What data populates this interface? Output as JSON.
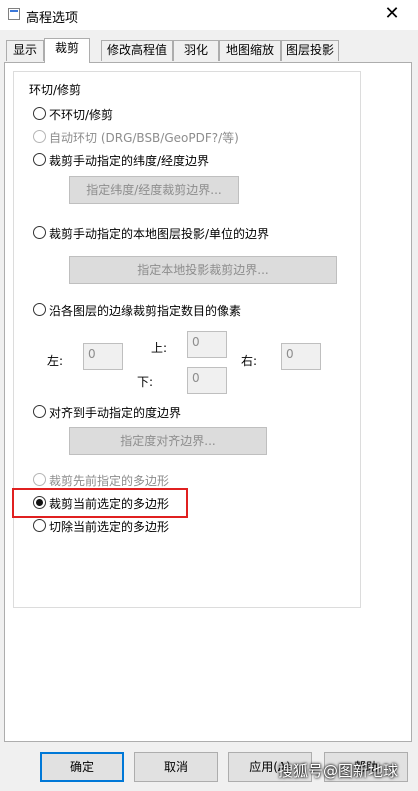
{
  "window": {
    "title": "高程选项",
    "close_symbol": "✕"
  },
  "tabs": [
    "显示",
    "裁剪",
    "修改高程值",
    "羽化",
    "地图缩放",
    "图层投影"
  ],
  "crop": {
    "group_title": "环切/修剪",
    "options": {
      "no_crop": "不环切/修剪",
      "auto_crop": "自动环切 (DRG/BSB/GeoPDF?/等)",
      "manual_latlon": "裁剪手动指定的纬度/经度边界",
      "manual_latlon_button": "指定纬度/经度裁剪边界...",
      "local_projection": "裁剪手动指定的本地图层投影/单位的边界",
      "local_projection_button": "指定本地投影裁剪边界...",
      "edge_pixels": "沿各图层的边缘裁剪指定数目的像素",
      "align_degree": "对齐到手动指定的度边界",
      "align_degree_button": "指定度对齐边界...",
      "prev_polygon": "裁剪先前指定的多边形",
      "current_polygon": "裁剪当前选定的多边形",
      "cut_polygon": "切除当前选定的多边形"
    },
    "pixels": {
      "left_label": "左:",
      "left_value": "0",
      "top_label": "上:",
      "top_value": "0",
      "right_label": "右:",
      "right_value": "0",
      "bottom_label": "下:",
      "bottom_value": "0"
    },
    "selected": "current_polygon"
  },
  "buttons": {
    "ok": "确定",
    "cancel": "取消",
    "apply": "应用(A)",
    "help": "帮助"
  },
  "watermark": "搜狐号@图新地球"
}
